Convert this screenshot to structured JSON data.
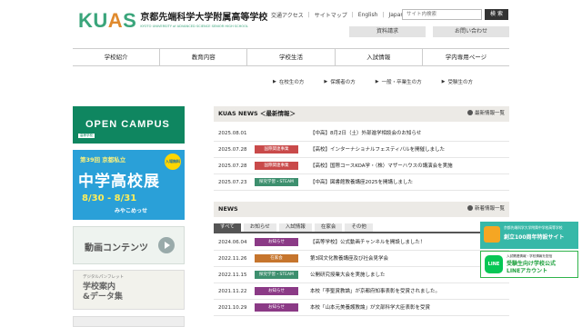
{
  "header": {
    "logo_mark": "KUAS",
    "logo_jp": "京都先端科学大学附属高等学校",
    "logo_en": "KYOTO UNIVERSITY of ADVANCED SCIENCE SENIOR HIGH SCHOOL",
    "utility_links": [
      "交通アクセス",
      "サイトマップ",
      "English",
      "Japan"
    ],
    "search_placeholder": "サイト内検索",
    "search_button": "検 索",
    "request_button": "資料請求",
    "contact_button": "お問い合わせ"
  },
  "gnav": [
    "学校紹介",
    "教育内容",
    "学校生活",
    "入試情報",
    "学内専用ページ"
  ],
  "subnav": [
    "在校生の方",
    "保護者の方",
    "一般・卒業生の方",
    "受験生の方"
  ],
  "banners": {
    "open_campus": "OPEN CAMPUS",
    "open_campus_tag": "高等学校",
    "fair_top": "第39回 京都私立",
    "fair_main": "中学高校展",
    "fair_date": "8/30 - 8/31",
    "fair_venue": "みやこめっせ",
    "fair_badge": "入場無料",
    "video": "動画コンテンツ",
    "pamphlet_small": "デジタルパンフレット",
    "pamphlet_main": "学校案内\n&データ集"
  },
  "kuas_news": {
    "title": "KUAS NEWS ＜最新情報＞",
    "link": "最新情報一覧",
    "items": [
      {
        "date": "2025.08.01",
        "tag": "",
        "title": "【中高】8月2日（土）外部進学相談会のお知らせ"
      },
      {
        "date": "2025.07.28",
        "tag": "国際関連事業",
        "title": "【高校】インターナショナルフェスティバルを開催しました"
      },
      {
        "date": "2025.07.28",
        "tag": "国際関連事業",
        "title": "【高校】国際コースKOA学・（株）マザーハウスの講演会を実施"
      },
      {
        "date": "2025.07.23",
        "tag": "探究学習・STEAM",
        "title": "【中高】図書館教養講座2025を開講しました"
      }
    ]
  },
  "news": {
    "title": "NEWS",
    "link": "新着情報一覧",
    "tabs": [
      "すべて",
      "お知らせ",
      "入試情報",
      "在家会",
      "その他"
    ],
    "items": [
      {
        "date": "2024.06.04",
        "tag": "お知らせ",
        "title": "【高等学校】公式動画チャンネルを開設しました！"
      },
      {
        "date": "2022.11.26",
        "tag": "在家会",
        "title": "第3回文化教養講座及び社会見学会"
      },
      {
        "date": "2022.11.15",
        "tag": "探究学習・STEAM",
        "title": "公開研究授業大会を実施しました"
      },
      {
        "date": "2021.11.22",
        "tag": "お知らせ",
        "title": "本校「李聖賞教論」が京都府知事表彰を受賞されました。"
      },
      {
        "date": "2021.10.29",
        "tag": "お知らせ",
        "title": "本校「山本元美養護教論」が文部科学大臣表彰を受賞"
      }
    ]
  },
  "float": {
    "anniv_small": "京都先端科学大学附属中学校高等学校",
    "anniv_main": "創立100周年特設サイト",
    "line_small": "入試関連情報・学校情報を配信",
    "line_main": "受験生向け学校公式\nLINEアカウント",
    "line_icon": "LINE"
  },
  "colors": {
    "tag_red": "#c94a4a",
    "tag_purple": "#8b3a86",
    "tag_green": "#3d8f6e",
    "tag_orange": "#c6752d",
    "brand_green": "#3aa57b"
  }
}
